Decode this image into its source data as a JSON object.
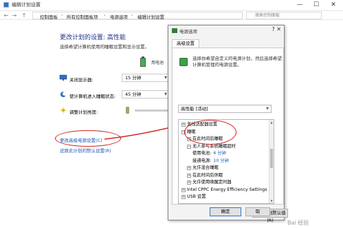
{
  "window": {
    "title": "编辑计划设置",
    "minimize": "—",
    "maximize": "☐",
    "close": "✕"
  },
  "address": {
    "back": "←",
    "forward": "→",
    "up": "↑",
    "breadcrumbs": [
      "控制面板",
      "所有控制面板项",
      "电源选项",
      "编辑计划设置"
    ],
    "search_placeholder": "搜索控制面板"
  },
  "main": {
    "title": "更改计划的设置: 高性能",
    "subtitle": "选择希望计算机使用的睡眠设置和显示设置。",
    "battery_header": "用电池",
    "rows": [
      {
        "label": "关闭显示器:",
        "value": "15 分钟"
      },
      {
        "label": "使计算机进入睡眠状态:",
        "value": "45 分钟"
      },
      {
        "label": "调整计划亮度:",
        "value": ""
      }
    ],
    "brightness_level": 0.1,
    "links": {
      "advanced": "更改高级电源设置(C)",
      "restore": "还原此计划的默认设置(R)"
    }
  },
  "dialog": {
    "title": "电源选项",
    "close": "?  ✕",
    "tab": "高级设置",
    "description": "选择你希望自定义的电源计划，然后选择希望计算机管理的电源设置。",
    "plan": "高性能 [活动]",
    "tree": [
      {
        "text": "无线适配器设置",
        "exp": "+",
        "indent": 0
      },
      {
        "text": "睡眠",
        "exp": "−",
        "indent": 0
      },
      {
        "text": "在此时间后睡眠",
        "exp": "+",
        "indent": 1
      },
      {
        "text": "无人参与系统睡眠超时",
        "exp": "−",
        "indent": 1
      },
      {
        "text": "使用电池:",
        "value": "6 分钟",
        "exp": "",
        "indent": 2
      },
      {
        "text": "接通电源:",
        "value": "10 分钟",
        "exp": "",
        "indent": 2
      },
      {
        "text": "允许混合睡眠",
        "exp": "+",
        "indent": 1
      },
      {
        "text": "在此时间后休眠",
        "exp": "+",
        "indent": 1
      },
      {
        "text": "允许使用唤醒定时器",
        "exp": "+",
        "indent": 1
      },
      {
        "text": "Intel CPPC Energy Efficiency Settings",
        "exp": "+",
        "indent": 0
      },
      {
        "text": "USB 设置",
        "exp": "+",
        "indent": 0
      }
    ],
    "restore_button": "还原计划默认值(R)",
    "ok_button": "确定",
    "cancel_button": "取"
  },
  "watermark": "Bai 经验"
}
